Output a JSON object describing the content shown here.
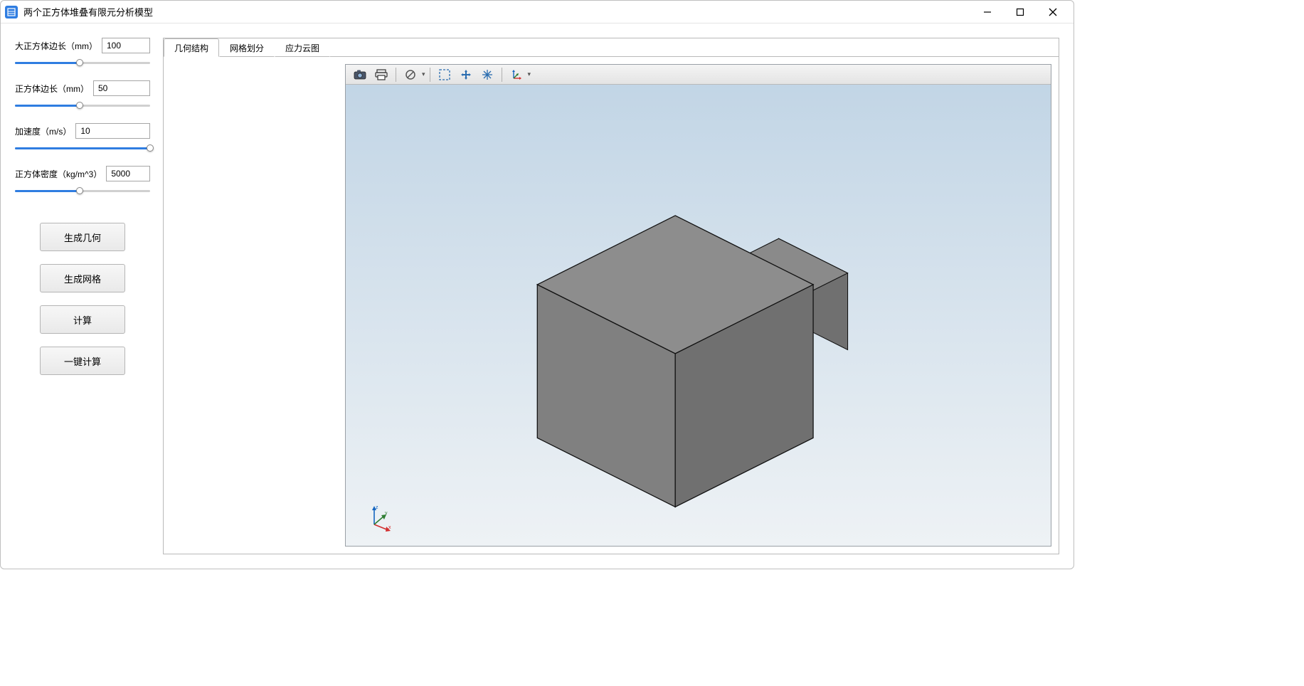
{
  "window": {
    "title": "两个正方体堆叠有限元分析模型"
  },
  "params": {
    "big_cube": {
      "label": "大正方体边长（mm）",
      "value": "100",
      "fill_pct": 48
    },
    "cube": {
      "label": "正方体边长（mm）",
      "value": "50",
      "fill_pct": 48
    },
    "accel": {
      "label": "加速度（m/s）",
      "value": "10",
      "fill_pct": 100
    },
    "density": {
      "label": "正方体密度（kg/m^3）",
      "value": "5000",
      "fill_pct": 48
    }
  },
  "buttons": {
    "gen_geom": "生成几何",
    "gen_mesh": "生成网格",
    "compute": "计算",
    "one_click": "一键计算"
  },
  "tabs": {
    "geom": "几何结构",
    "mesh": "网格划分",
    "stress": "应力云图"
  },
  "toolbar_icons": {
    "camera": "camera-icon",
    "print": "print-icon",
    "reset": "reset-icon",
    "zoom_box": "zoom-box-icon",
    "pan": "pan-icon",
    "fit": "fit-icon",
    "orient": "orient-icon"
  },
  "triad": {
    "x": "x",
    "y": "y",
    "z": "z"
  }
}
